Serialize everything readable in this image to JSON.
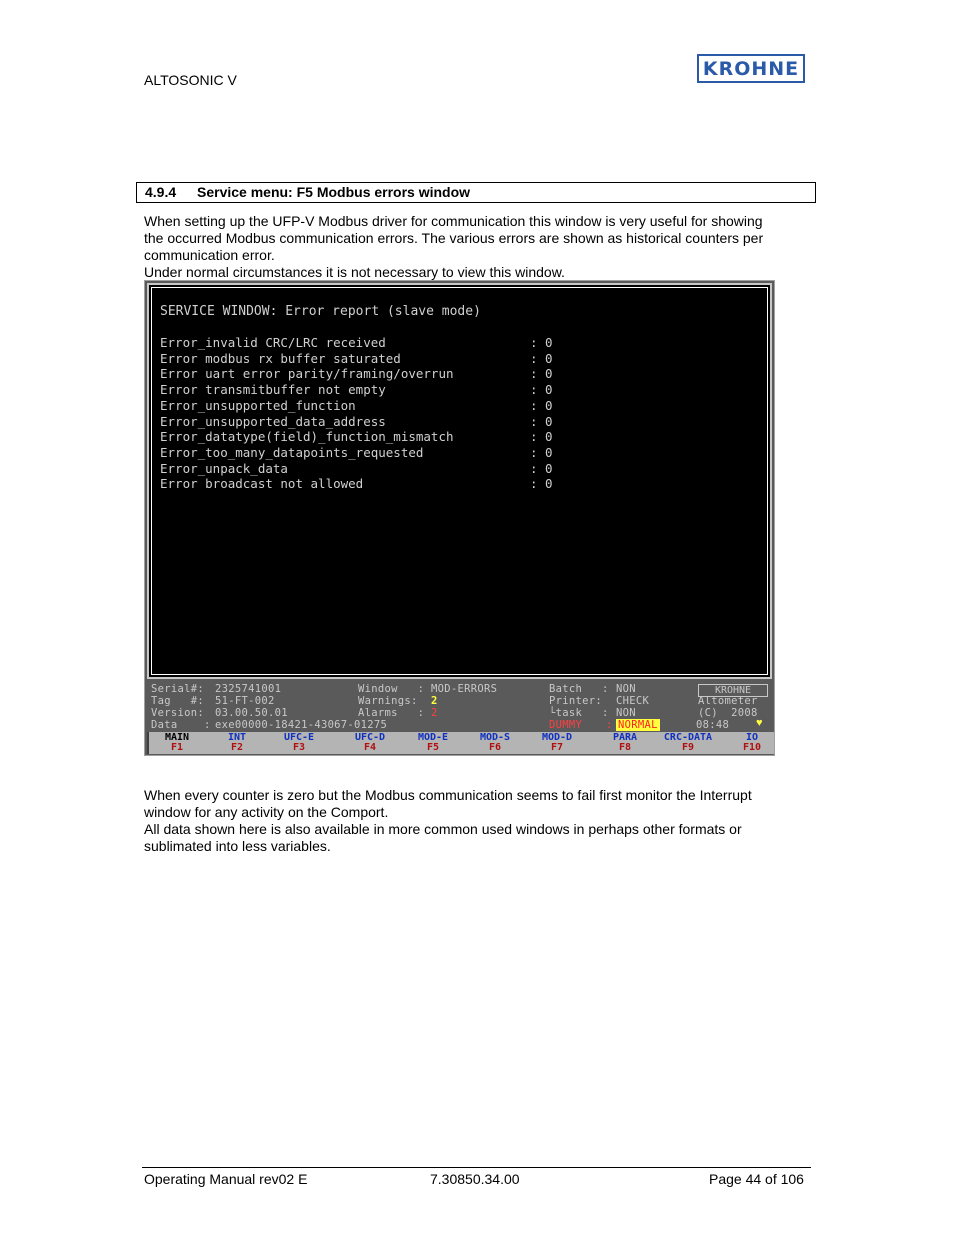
{
  "header": {
    "product": "ALTOSONIC V",
    "logo_text": "KROHNE",
    "logo_color": "#2a5aa8"
  },
  "section": {
    "number": "4.9.4",
    "title": "Service menu: F5 Modbus errors window"
  },
  "intro_paragraph": [
    "When setting up the UFP-V Modbus driver for communication this window is very useful for showing",
    "the occurred Modbus communication errors. The various errors are shown as historical counters per",
    "communication error.",
    "Under normal circumstances it is not necessary to view this window."
  ],
  "terminal": {
    "title": "SERVICE WINDOW: Error report (slave mode)",
    "errors": [
      {
        "label": "Error_invalid CRC/LRC received",
        "value": "0"
      },
      {
        "label": "Error modbus rx buffer saturated",
        "value": "0"
      },
      {
        "label": "Error uart error parity/framing/overrun",
        "value": "0"
      },
      {
        "label": "Error transmitbuffer not empty",
        "value": "0"
      },
      {
        "label": "Error_unsupported_function",
        "value": "0"
      },
      {
        "label": "Error_unsupported_data_address",
        "value": "0"
      },
      {
        "label": "Error_datatype(field)_function_mismatch",
        "value": "0"
      },
      {
        "label": "Error_too_many_datapoints_requested",
        "value": "0"
      },
      {
        "label": "Error_unpack_data",
        "value": "0"
      },
      {
        "label": "Error broadcast not allowed",
        "value": "0"
      }
    ]
  },
  "status_bar": {
    "serial_label": "Serial#:",
    "serial": "2325741001",
    "tag_label": "Tag   #:",
    "tag": "51-FT-002",
    "version_label": "Version:",
    "version": "03.00.50.01",
    "data_label": "Data    :",
    "data": "exe00000-18421-43067-01275",
    "window_label": "Window   :",
    "window": "MOD-ERRORS",
    "warnings_label": "Warnings:",
    "warnings": "2",
    "alarms_label": "Alarms   :",
    "alarms": "2",
    "batch_label": "Batch   :",
    "batch": "NON",
    "printer_label": "Printer:",
    "printer": "CHECK",
    "task_label": "└task   :",
    "task": "NON",
    "mode_label": "DUMMY",
    "mode_sep": ":",
    "mode": "NORMAL",
    "brand_box": "KROHNE",
    "brand_line2": "Altometer",
    "brand_line3": "(C)  2008",
    "time": "08:48",
    "heart_icon": "♥"
  },
  "function_keys": [
    {
      "label": "MAIN",
      "key": "F1",
      "active": true
    },
    {
      "label": "INT",
      "key": "F2"
    },
    {
      "label": "UFC-E",
      "key": "F3"
    },
    {
      "label": "UFC-D",
      "key": "F4"
    },
    {
      "label": "MOD-E",
      "key": "F5"
    },
    {
      "label": "MOD-S",
      "key": "F6"
    },
    {
      "label": "MOD-D",
      "key": "F7"
    },
    {
      "label": "PARA",
      "key": "F8"
    },
    {
      "label": "CRC-DATA",
      "key": "F9"
    },
    {
      "label": "IO",
      "key": "F10"
    }
  ],
  "closing_paragraph": [
    "When every counter is zero but the Modbus communication seems to fail first monitor the Interrupt",
    "window for any activity on the Comport.",
    "All data shown here is also available in more common used windows in perhaps other formats or",
    "sublimated into less variables."
  ],
  "footer": {
    "left": "Operating Manual  rev02 E",
    "center": "7.30850.34.00",
    "right": "Page 44 of 106"
  }
}
